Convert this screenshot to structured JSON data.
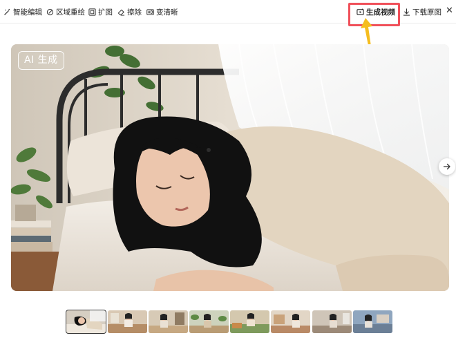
{
  "toolbar": {
    "smart_edit": "智能编辑",
    "region_repaint": "区域重绘",
    "expand": "扩图",
    "erase": "擦除",
    "clarity": "变清晰",
    "generate_video": "生成视频",
    "download": "下载原图",
    "close": "✕"
  },
  "image": {
    "badge": "AI 生成"
  },
  "thumbnails": {
    "count": 8,
    "selected_index": 0
  },
  "colors": {
    "highlight": "#f0505a",
    "arrow": "#f5bd1f"
  },
  "icons": {
    "smart_edit": "magic-wand-icon",
    "region_repaint": "brush-icon",
    "expand": "expand-icon",
    "erase": "eraser-icon",
    "clarity": "hd-icon",
    "generate_video": "video-icon",
    "download": "download-icon",
    "next": "arrow-right-icon"
  }
}
